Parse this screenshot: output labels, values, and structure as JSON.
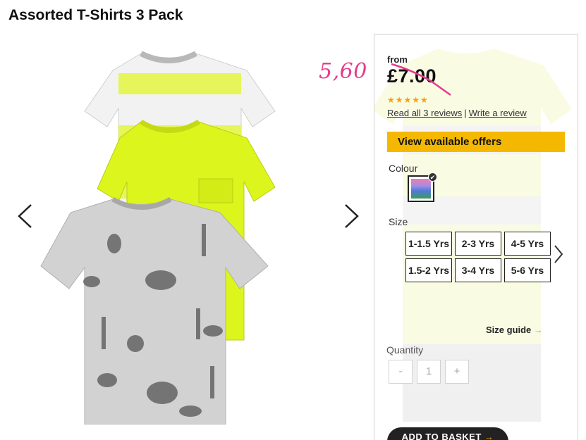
{
  "page": {
    "title": "Assorted T-Shirts 3 Pack"
  },
  "gallery": {
    "prev_icon": "chevron-left-icon",
    "next_icon": "chevron-right-icon"
  },
  "product": {
    "from_label": "from",
    "price": "£7.00",
    "rating": 5,
    "stars": "★★★★★",
    "reviews_link": "Read all 3 reviews",
    "separator": "|",
    "write_review": "Write a review",
    "offers_button": "View available offers",
    "colour_label": "Colour",
    "size_label": "Size",
    "sizes": [
      "1-1.5 Yrs",
      "2-3 Yrs",
      "4-5 Yrs",
      "1.5-2 Yrs",
      "3-4 Yrs",
      "5-6 Yrs"
    ],
    "size_guide": "Size guide",
    "size_guide_arrow": "→",
    "quantity_label": "Quantity",
    "quantity_minus": "-",
    "quantity_value": "1",
    "quantity_plus": "+",
    "add_to_basket": "ADD TO BASKET",
    "basket_arrow": "→"
  },
  "annotation": {
    "handwritten_price": "5,60",
    "color": "#e63a8c"
  },
  "colors": {
    "accent": "#f5b800",
    "neon": "#dcf51c",
    "stars": "#f5a300"
  }
}
